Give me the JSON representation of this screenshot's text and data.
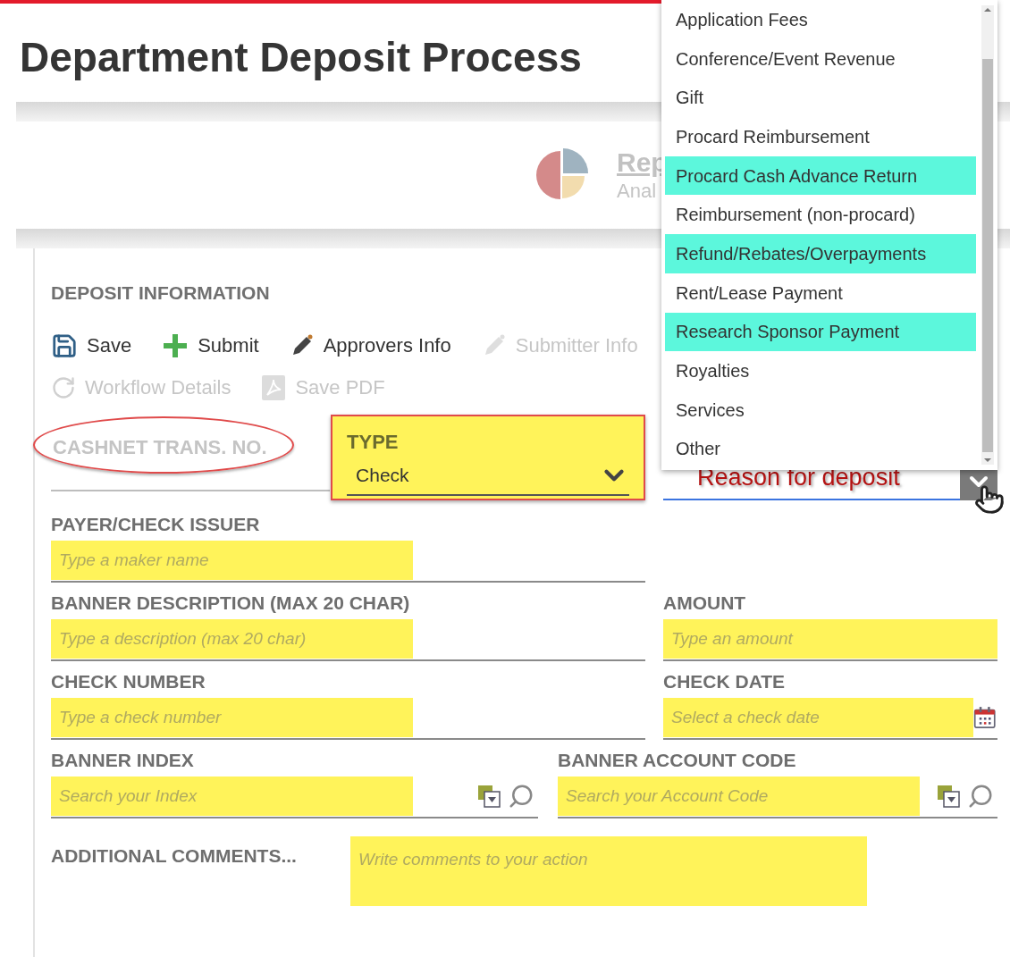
{
  "header": {
    "title": "Department Deposit Process"
  },
  "banner": {
    "link": "Rep",
    "subtitle": "Anal"
  },
  "section": {
    "title": "DEPOSIT INFORMATION"
  },
  "toolbar": [
    [
      {
        "label": "Save",
        "kind": "save",
        "disabled": false
      },
      {
        "label": "Submit",
        "kind": "submit",
        "disabled": false
      },
      {
        "label": "Approvers Info",
        "kind": "edit",
        "disabled": false
      },
      {
        "label": "Submitter Info",
        "kind": "edit",
        "disabled": true
      }
    ],
    [
      {
        "label": "Workflow Details",
        "kind": "workflow",
        "disabled": true
      },
      {
        "label": "Save PDF",
        "kind": "pdf",
        "disabled": true
      }
    ]
  ],
  "cashnet": {
    "label": "CASHNET TRANS. NO.",
    "disabled": true,
    "circled": true
  },
  "type_select": {
    "label": "TYPE",
    "value": "Check",
    "outlined": true
  },
  "reason_select": {
    "annotation": "Reason for deposit"
  },
  "rows": [
    {
      "fields": [
        {
          "label": "PAYER/CHECK ISSUER",
          "placeholder": "Type a maker name",
          "kind": "text"
        }
      ]
    },
    {
      "fields": [
        {
          "label": "BANNER DESCRIPTION (MAX 20 CHAR)",
          "placeholder": "Type a description (max 20 char)",
          "kind": "text"
        },
        {
          "label": "AMOUNT",
          "placeholder": "Type an amount",
          "kind": "text"
        }
      ]
    },
    {
      "fields": [
        {
          "label": "CHECK NUMBER",
          "placeholder": "Type a check number",
          "kind": "text"
        },
        {
          "label": "CHECK DATE",
          "placeholder": "Select a check date",
          "kind": "date"
        }
      ]
    },
    {
      "fields": [
        {
          "label": "BANNER INDEX",
          "placeholder": "Search your Index",
          "kind": "lookup"
        },
        {
          "label": "BANNER ACCOUNT CODE",
          "placeholder": "Search your Account Code",
          "kind": "lookup"
        }
      ]
    }
  ],
  "comments": {
    "label": "ADDITIONAL COMMENTS...",
    "placeholder": "Write comments to your action"
  },
  "dropdown": {
    "options": [
      {
        "label": "Application Fees",
        "highlighted": false
      },
      {
        "label": "Conference/Event Revenue",
        "highlighted": false
      },
      {
        "label": "Gift",
        "highlighted": false
      },
      {
        "label": "Procard Reimbursement",
        "highlighted": false
      },
      {
        "label": "Procard Cash Advance Return",
        "highlighted": true
      },
      {
        "label": "Reimbursement (non-procard)",
        "highlighted": false
      },
      {
        "label": "Refund/Rebates/Overpayments",
        "highlighted": true
      },
      {
        "label": "Rent/Lease Payment",
        "highlighted": false
      },
      {
        "label": "Research Sponsor Payment",
        "highlighted": true
      },
      {
        "label": "Royalties",
        "highlighted": false
      },
      {
        "label": "Services",
        "highlighted": false
      },
      {
        "label": "Other",
        "highlighted": false
      }
    ]
  }
}
